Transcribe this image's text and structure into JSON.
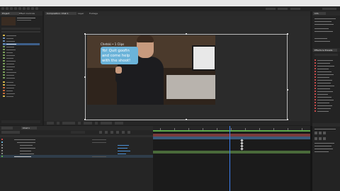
{
  "app": {
    "title": "After Effects"
  },
  "tabs": {
    "project": "Project",
    "effects": "Effect Controls",
    "composition": "Composition: Chat 1",
    "layer": "Layer",
    "footage": "Footage",
    "right_top": "Info",
    "right_effects": "Effects & Presets",
    "timeline": "Chat 1"
  },
  "comp": {
    "bubble_name": "Chetski • 1 Clips",
    "bubble_text": "Yo! Quit goofin and come help with the shoot!"
  },
  "colors": {
    "accent": "#3d7ff0",
    "bubble": "#6bb3d9",
    "work_area": "#5da84a",
    "label_red": "#c84848"
  }
}
